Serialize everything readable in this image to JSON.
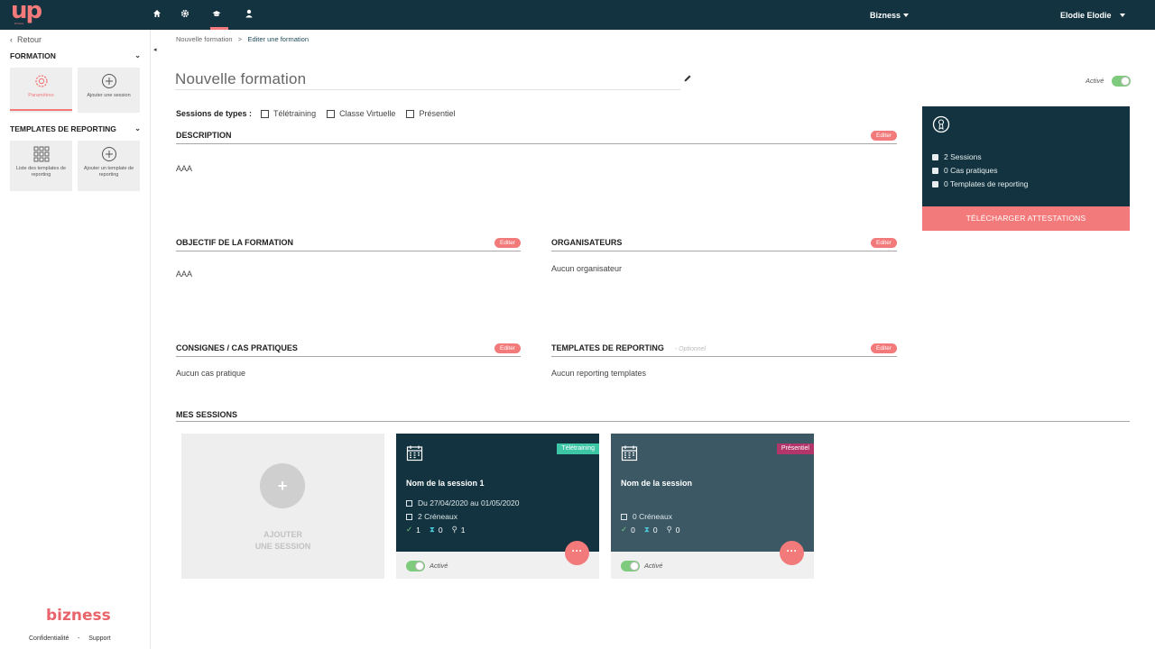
{
  "logo": {
    "text": "up",
    "sub": "bizness"
  },
  "topbar": {
    "nav": [
      "home-icon",
      "gear-icon",
      "graduation-cap-icon",
      "user-icon"
    ],
    "org_menu": "Bizness",
    "user_menu": "Elodie Elodie"
  },
  "sidebar": {
    "back_label": "Retour",
    "formation_title": "FORMATION",
    "formation_tiles": [
      {
        "label": "Paramètres"
      },
      {
        "label": "Ajouter une session"
      }
    ],
    "reporting_title": "TEMPLATES DE REPORTING",
    "reporting_tiles": [
      {
        "label": "Liste des templates de reporting"
      },
      {
        "label": "Ajouter un template de reporting"
      }
    ],
    "brand": "bizness",
    "footer_privacy": "Confidentialité",
    "footer_sep": "-",
    "footer_support": "Support"
  },
  "breadcrumb": {
    "parent": "Nouvelle formation",
    "sep": ">",
    "current": "Editer une formation"
  },
  "formation": {
    "title_placeholder": "Nouvelle formation",
    "active_label": "Activé",
    "types_label": "Sessions de types :",
    "types": [
      "Télétraining",
      "Classe Virtuelle",
      "Présentiel"
    ]
  },
  "sections": {
    "edit_label": "Editer",
    "description": {
      "title": "DESCRIPTION",
      "body": "AAA"
    },
    "objectif": {
      "title": "OBJECTIF DE LA FORMATION",
      "body": "AAA"
    },
    "organisateurs": {
      "title": "ORGANISATEURS",
      "body": "Aucun organisateur"
    },
    "consignes": {
      "title": "CONSIGNES / CAS PRATIQUES",
      "body": "Aucun cas pratique"
    },
    "templates": {
      "title": "TEMPLATES DE REPORTING",
      "optional": "- Optionnel",
      "body": "Aucun reporting templates"
    }
  },
  "stats": {
    "sessions": "2 Sessions",
    "cas": "0 Cas pratiques",
    "templates": "0 Templates de reporting",
    "download_label": "TÉLÉCHARGER ATTESTATIONS"
  },
  "sessions": {
    "title": "MES SESSIONS",
    "add_line1": "AJOUTER",
    "add_line2": "UNE SESSION",
    "cards": [
      {
        "name": "Nom de la session 1",
        "badge": "Télétraining",
        "badge_color": "#3cc6a6",
        "bg": "#12333f",
        "dates": "Du 27/04/2020 au 01/05/2020",
        "creneaux": "2 Créneaux",
        "count_done": "1",
        "count_wait": "0",
        "count_pin": "1",
        "active_label": "Activé"
      },
      {
        "name": "Nom de la session",
        "badge": "Présentiel",
        "badge_color": "#b3366b",
        "bg": "#3c5865",
        "creneaux": "0 Créneaux",
        "count_done": "0",
        "count_wait": "0",
        "count_pin": "0",
        "active_label": "Activé"
      }
    ]
  },
  "colors": {
    "navy": "#12333f",
    "accent": "#f37a7a",
    "green": "#7ecb7e"
  }
}
